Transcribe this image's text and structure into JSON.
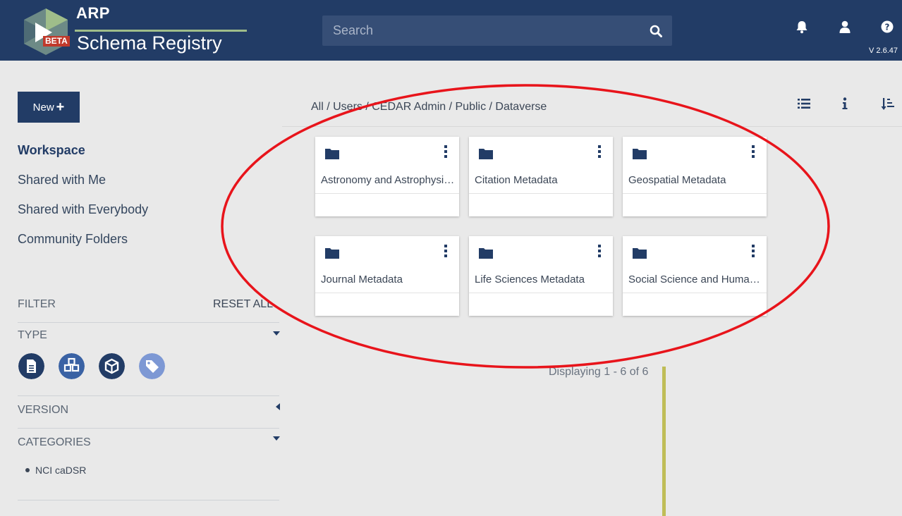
{
  "header": {
    "logo_title": "ARP",
    "logo_badge": "BETA",
    "logo_subtitle": "Schema Registry",
    "search_placeholder": "Search",
    "version": "V 2.6.47",
    "icons": [
      "search-icon",
      "bell-icon",
      "user-icon",
      "help-icon"
    ]
  },
  "sidebar": {
    "new_button": "New",
    "nav": [
      {
        "label": "Workspace",
        "active": true
      },
      {
        "label": "Shared with Me",
        "active": false
      },
      {
        "label": "Shared with Everybody",
        "active": false
      },
      {
        "label": "Community Folders",
        "active": false
      }
    ],
    "filter_label": "FILTER",
    "reset_label": "RESET ALL",
    "sections": {
      "type": "TYPE",
      "version": "VERSION",
      "categories": "CATEGORIES"
    },
    "type_icons": [
      "document-icon",
      "cubes-icon",
      "cube-icon",
      "tag-icon"
    ],
    "categories": [
      "NCI caDSR"
    ]
  },
  "main": {
    "breadcrumb": "All / Users / CEDAR Admin / Public / Dataverse",
    "toolbar_icons": [
      "list-view-icon",
      "info-icon",
      "sort-icon"
    ],
    "folders": [
      {
        "name": "Astronomy and Astrophysics Metadata"
      },
      {
        "name": "Citation Metadata"
      },
      {
        "name": "Geospatial Metadata"
      },
      {
        "name": "Journal Metadata"
      },
      {
        "name": "Life Sciences Metadata"
      },
      {
        "name": "Social Science and Humanities Metadata"
      }
    ],
    "displaying": "Displaying 1 - 6 of 6"
  },
  "colors": {
    "header_bg": "#223c66",
    "accent": "#223c66",
    "annotation": "#e8141b"
  }
}
